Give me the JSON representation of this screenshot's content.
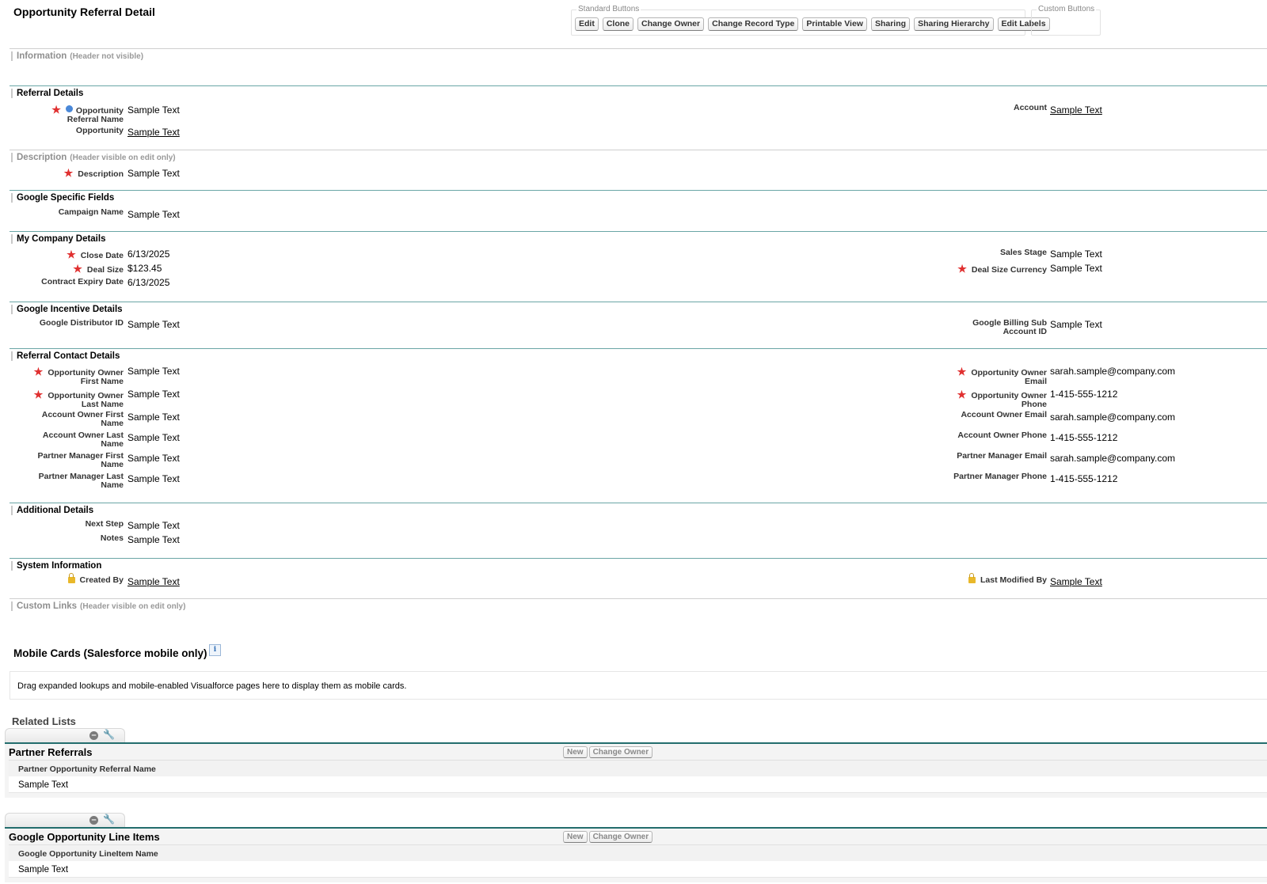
{
  "page_title": "Opportunity Referral Detail",
  "standard_buttons": {
    "legend": "Standard Buttons",
    "buttons": [
      "Edit",
      "Clone",
      "Change Owner",
      "Change Record Type",
      "Printable View",
      "Sharing",
      "Sharing Hierarchy",
      "Edit Labels"
    ]
  },
  "custom_buttons": {
    "legend": "Custom Buttons"
  },
  "sections": {
    "information": {
      "title": "Information",
      "note": "(Header not visible)"
    },
    "referral_details": {
      "title": "Referral Details",
      "opportunity_referral_name": {
        "label": "Opportunity Referral Name",
        "value": "Sample Text"
      },
      "opportunity": {
        "label": "Opportunity",
        "value": "Sample Text"
      },
      "account": {
        "label": "Account",
        "value": "Sample Text"
      }
    },
    "description": {
      "title": "Description",
      "note": "(Header visible on edit only)",
      "description": {
        "label": "Description",
        "value": "Sample Text"
      }
    },
    "google_specific": {
      "title": "Google Specific Fields",
      "campaign_name": {
        "label": "Campaign Name",
        "value": "Sample Text"
      }
    },
    "my_company": {
      "title": "My Company Details",
      "close_date": {
        "label": "Close Date",
        "value": "6/13/2025"
      },
      "deal_size": {
        "label": "Deal Size",
        "value": "$123.45"
      },
      "contract_expiry": {
        "label": "Contract Expiry Date",
        "value": "6/13/2025"
      },
      "sales_stage": {
        "label": "Sales Stage",
        "value": "Sample Text"
      },
      "deal_size_currency": {
        "label": "Deal Size Currency",
        "value": "Sample Text"
      }
    },
    "google_incentive": {
      "title": "Google Incentive Details",
      "distributor_id": {
        "label": "Google Distributor ID",
        "value": "Sample Text"
      },
      "billing_sub": {
        "label": "Google Billing Sub Account ID",
        "value": "Sample Text"
      }
    },
    "referral_contact": {
      "title": "Referral Contact Details",
      "opp_owner_first": {
        "label": "Opportunity Owner First Name",
        "value": "Sample Text"
      },
      "opp_owner_last": {
        "label": "Opportunity Owner Last Name",
        "value": "Sample Text"
      },
      "acct_owner_first": {
        "label": "Account Owner First Name",
        "value": "Sample Text"
      },
      "acct_owner_last": {
        "label": "Account Owner Last Name",
        "value": "Sample Text"
      },
      "pm_first": {
        "label": "Partner Manager First Name",
        "value": "Sample Text"
      },
      "pm_last": {
        "label": "Partner Manager Last Name",
        "value": "Sample Text"
      },
      "opp_owner_email": {
        "label": "Opportunity Owner Email",
        "value": "sarah.sample@company.com"
      },
      "opp_owner_phone": {
        "label": "Opportunity Owner Phone",
        "value": "1-415-555-1212"
      },
      "acct_owner_email": {
        "label": "Account Owner Email",
        "value": "sarah.sample@company.com"
      },
      "acct_owner_phone": {
        "label": "Account Owner Phone",
        "value": "1-415-555-1212"
      },
      "pm_email": {
        "label": "Partner Manager Email",
        "value": "sarah.sample@company.com"
      },
      "pm_phone": {
        "label": "Partner Manager Phone",
        "value": "1-415-555-1212"
      }
    },
    "additional": {
      "title": "Additional Details",
      "next_step": {
        "label": "Next Step",
        "value": "Sample Text"
      },
      "notes": {
        "label": "Notes",
        "value": "Sample Text"
      }
    },
    "system": {
      "title": "System Information",
      "created_by": {
        "label": "Created By",
        "value": "Sample Text"
      },
      "last_modified_by": {
        "label": "Last Modified By",
        "value": "Sample Text"
      }
    },
    "custom_links": {
      "title": "Custom Links",
      "note": "(Header visible on edit only)"
    }
  },
  "mobile_cards": {
    "title": "Mobile Cards (Salesforce mobile only)",
    "info_icon": "i",
    "hint": "Drag expanded lookups and mobile-enabled Visualforce pages here to display them as mobile cards."
  },
  "related_lists": {
    "title": "Related Lists",
    "lists": [
      {
        "name": "Partner Referrals",
        "buttons": [
          "New",
          "Change Owner"
        ],
        "column": "Partner Opportunity Referral Name",
        "row": "Sample Text"
      },
      {
        "name": "Google Opportunity Line Items",
        "buttons": [
          "New",
          "Change Owner"
        ],
        "column": "Google Opportunity LineItem Name",
        "row": "Sample Text"
      }
    ]
  },
  "symbols": {
    "required": "★",
    "minus": "–",
    "wrench": "🔧"
  },
  "colors": {
    "section_line": "#6aa6a6",
    "required_star": "#e03030",
    "related_list_bar": "#236d6d"
  }
}
